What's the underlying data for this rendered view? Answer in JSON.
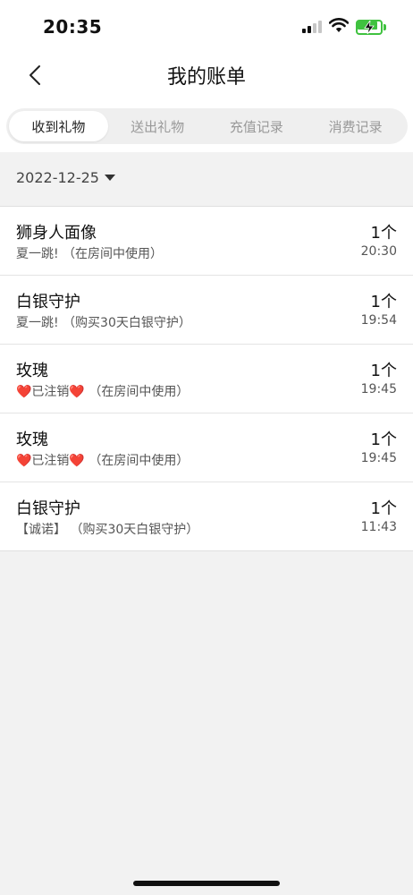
{
  "status": {
    "time": "20:35"
  },
  "nav": {
    "title": "我的账单",
    "back_icon": "chevron-left-icon"
  },
  "tabs": [
    {
      "label": "收到礼物",
      "active": true
    },
    {
      "label": "送出礼物",
      "active": false
    },
    {
      "label": "充值记录",
      "active": false
    },
    {
      "label": "消费记录",
      "active": false
    }
  ],
  "filter": {
    "date": "2022-12-25"
  },
  "records": [
    {
      "name": "狮身人面像",
      "desc": "夏一跳!  （在房间中使用）",
      "count": "1个",
      "time": "20:30"
    },
    {
      "name": "白银守护",
      "desc": "夏一跳!  （购买30天白银守护）",
      "count": "1个",
      "time": "19:54"
    },
    {
      "name": "玫瑰",
      "desc": "❤️已注销❤️  （在房间中使用）",
      "count": "1个",
      "time": "19:45"
    },
    {
      "name": "玫瑰",
      "desc": "❤️已注销❤️  （在房间中使用）",
      "count": "1个",
      "time": "19:45"
    },
    {
      "name": "白银守护",
      "desc": "【诚诺】 （购买30天白银守护）",
      "count": "1个",
      "time": "11:43"
    }
  ],
  "colors": {
    "battery": "#3fc23f",
    "background": "#f2f2f2",
    "active_tab_bg": "#ffffff"
  }
}
